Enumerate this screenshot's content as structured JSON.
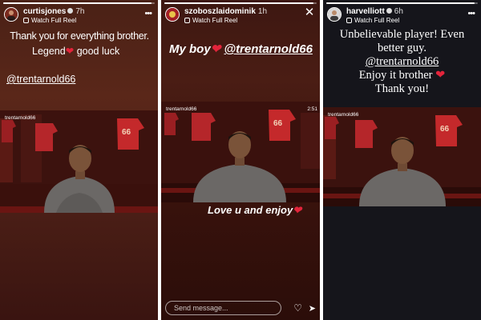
{
  "stories": [
    {
      "username": "curtisjones",
      "age": "7h",
      "watch_reel": "Watch Full Reel",
      "progress": 0.98,
      "text_lines": [
        "Thank you for everything brother.",
        "Legend",
        "good luck"
      ],
      "mention": "@trentarnold66",
      "reel_handle": "trentarnold66"
    },
    {
      "username": "szoboszlaidominik",
      "age": "1h",
      "watch_reel": "Watch Full Reel",
      "progress": 0.98,
      "text_top": "My boy",
      "mention": "@trentarnold66",
      "text_bottom": "Love u and enjoy",
      "reel_handle": "trentarnold66",
      "timecode": "2:51",
      "send_placeholder": "Send message..."
    },
    {
      "username": "harvelliott",
      "age": "6h",
      "watch_reel": "Watch Full Reel",
      "progress": 0.98,
      "text_lines": [
        "Unbelievable player! Even",
        "better guy.",
        "@trentarnold66",
        "Enjoy it brother",
        "Thank you!"
      ],
      "reel_handle": "trentarnold66"
    }
  ],
  "icons": {
    "heart": "❤",
    "more": "•••",
    "close": "✕",
    "like": "♡",
    "send": "➤"
  },
  "colors": {
    "heart": "#e3243b",
    "story1_bg": "#4a2116",
    "story2_bg": "#3d1711",
    "story3_bg": "#15151b"
  }
}
